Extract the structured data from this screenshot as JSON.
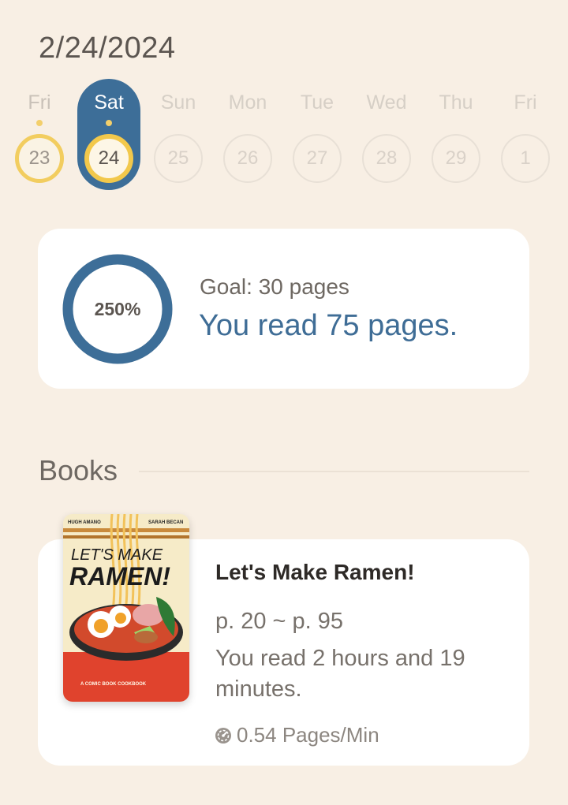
{
  "header": {
    "date": "2/24/2024"
  },
  "week": [
    {
      "name": "Fri",
      "num": "23",
      "has_read": true,
      "selected": false
    },
    {
      "name": "Sat",
      "num": "24",
      "has_read": true,
      "selected": true
    },
    {
      "name": "Sun",
      "num": "25",
      "has_read": false,
      "selected": false
    },
    {
      "name": "Mon",
      "num": "26",
      "has_read": false,
      "selected": false
    },
    {
      "name": "Tue",
      "num": "27",
      "has_read": false,
      "selected": false
    },
    {
      "name": "Wed",
      "num": "28",
      "has_read": false,
      "selected": false
    },
    {
      "name": "Thu",
      "num": "29",
      "has_read": false,
      "selected": false
    },
    {
      "name": "Fri",
      "num": "1",
      "has_read": false,
      "selected": false
    }
  ],
  "goal": {
    "percent_label": "250%",
    "progress_fraction": 1.0,
    "goal_text": "Goal: 30 pages",
    "read_text": "You read 75 pages."
  },
  "books_section": {
    "title": "Books"
  },
  "book": {
    "title": "Let's Make Ramen!",
    "page_range": "p. 20 ~ p. 95",
    "duration": "You read 2 hours and 19 minutes.",
    "speed": "0.54 Pages/Min",
    "speed_icon": "speedometer-icon",
    "cover": {
      "author_left": "HUGH AMANO",
      "author_right": "SARAH BECAN",
      "line1": "LET'S MAKE",
      "line2": "RAMEN!",
      "tagline": "A COMIC BOOK COOKBOOK"
    }
  },
  "colors": {
    "background": "#f8efe4",
    "accent_blue": "#3d6e98",
    "accent_yellow": "#f2cd5f"
  }
}
